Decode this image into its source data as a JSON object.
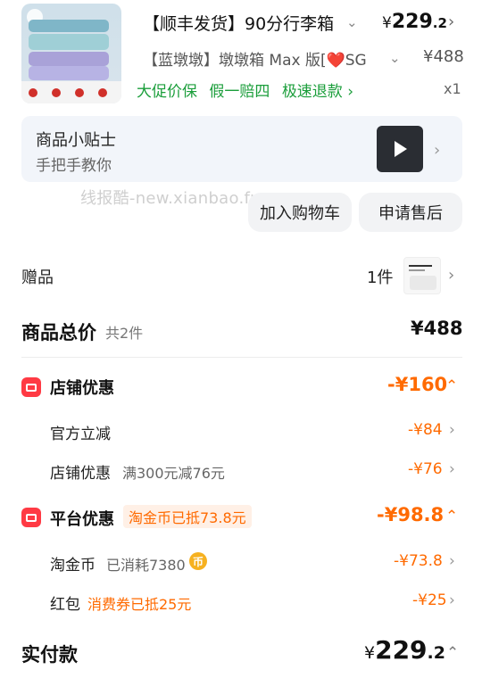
{
  "product": {
    "title": "【顺丰发货】90分行李箱",
    "spec": "【蓝墩墩】墩墩箱 Max 版[❤️SG",
    "price_currency": "¥",
    "price_int": "229",
    "price_dec": ".2",
    "original_price": "¥488",
    "tags": [
      "大促价保",
      "假一赔四",
      "极速退款 ›"
    ],
    "quantity": "x1"
  },
  "tips": {
    "title": "商品小贴士",
    "subtitle": "手把手教你"
  },
  "watermark": "线报酷-new.xianbao.fun",
  "actions": {
    "add_to_cart": "加入购物车",
    "after_sale": "申请售后"
  },
  "gift": {
    "label": "赠品",
    "count": "1件"
  },
  "summary": {
    "total_label": "商品总价",
    "total_count": "共2件",
    "total_value": "¥488"
  },
  "store_discount": {
    "title": "店铺优惠",
    "total": "-¥160",
    "rows": [
      {
        "label": "官方立减",
        "sub": "",
        "value": "-¥84"
      },
      {
        "label": "店铺优惠",
        "sub": "满300元减76元",
        "value": "-¥76"
      }
    ]
  },
  "platform_discount": {
    "title": "平台优惠",
    "badge": "淘金币已抵73.8元",
    "total": "-¥98.8",
    "coin": {
      "label": "淘金币",
      "sub": "已消耗7380",
      "coin_glyph": "币",
      "value": "-¥73.8"
    },
    "redpack": {
      "label": "红包",
      "sub": "消费券已抵25元",
      "value": "-¥25"
    }
  },
  "payment": {
    "label": "实付款",
    "currency": "¥",
    "int": "229",
    "dec": ".2"
  },
  "colors": {
    "accent": "#ff6a00",
    "green": "#1b9e3b",
    "red_icon": "#ff3a44"
  }
}
